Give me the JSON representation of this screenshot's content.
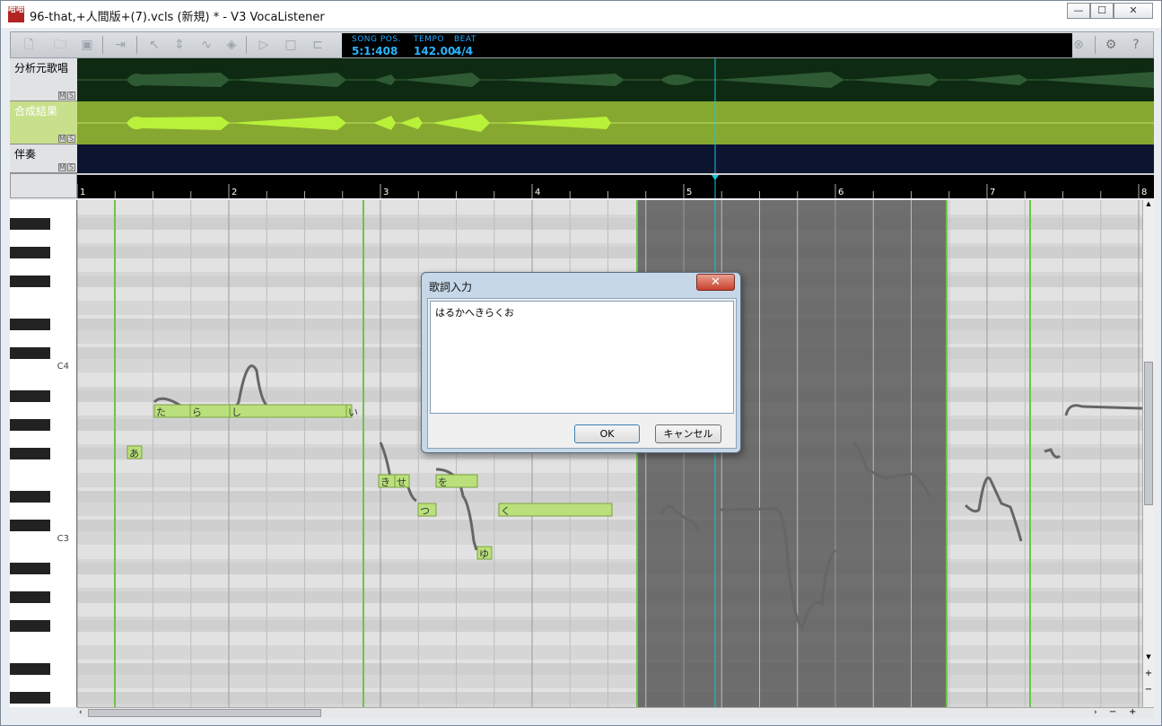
{
  "window": {
    "title": "96-that,+人間版+(7).vcls (新規) * - V3 VocaListener",
    "icon_text": "哈哈",
    "min": "—",
    "max": "☐",
    "close": "✕"
  },
  "toolbar": {
    "icons": [
      "new-icon",
      "open-icon",
      "save-icon",
      "export-icon",
      "pointer-icon",
      "updown-icon",
      "pitch-icon",
      "dynamics-icon",
      "play-icon",
      "stop-icon",
      "loop-icon",
      "stop-circle-icon",
      "gear-icon",
      "help-icon"
    ]
  },
  "lcd": {
    "song_pos_label": "SONG POS.",
    "tempo_label": "TEMPO",
    "beat_label": "BEAT",
    "song_pos": "5:1:408",
    "tempo": "142.00",
    "beat": "4/4"
  },
  "tracks": [
    {
      "name": "分析元歌唱",
      "m": "M",
      "s": "S"
    },
    {
      "name": "合成結果",
      "m": "M",
      "s": "S"
    },
    {
      "name": "伴奏",
      "m": "M",
      "s": "S"
    }
  ],
  "ruler": {
    "bars": [
      "1",
      "2",
      "3",
      "4",
      "5",
      "6",
      "7",
      "8"
    ]
  },
  "piano": {
    "c4": "C4",
    "c3": "C3"
  },
  "notes": [
    {
      "text": "た"
    },
    {
      "text": "ら"
    },
    {
      "text": "し"
    },
    {
      "text": "い"
    },
    {
      "text": "あ"
    },
    {
      "text": "き"
    },
    {
      "text": "せ"
    },
    {
      "text": "つ"
    },
    {
      "text": "を"
    },
    {
      "text": "ゆ"
    },
    {
      "text": "く"
    }
  ],
  "dialog": {
    "title": "歌詞入力",
    "close": "✕",
    "text": "はるかへきらくお",
    "ok": "OK",
    "cancel": "キャンセル"
  },
  "scroll": {
    "left": "‹",
    "right": "›",
    "minus": "−",
    "plus": "+",
    "up": "▲",
    "down": "▼"
  },
  "colors": {
    "accent": "#20a8ff",
    "note": "#b9e07a",
    "selection": "#6b6b6b",
    "playhead": "#10c8d8"
  }
}
